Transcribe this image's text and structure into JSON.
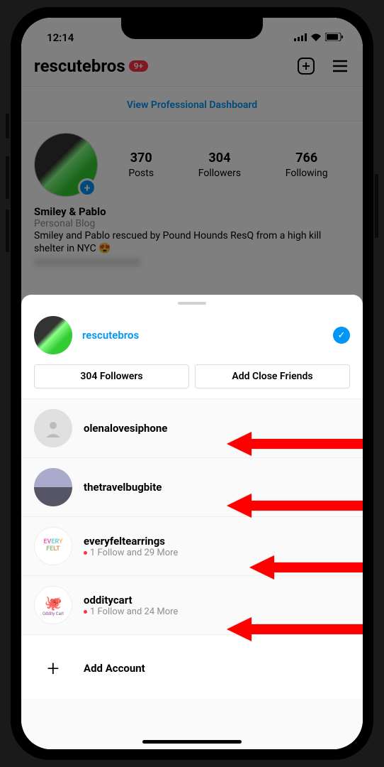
{
  "status": {
    "time": "12:14"
  },
  "header": {
    "username": "rescutebros",
    "notif_count": "9+"
  },
  "dashboard_link": "View Professional Dashboard",
  "stats": {
    "posts": {
      "value": "370",
      "label": "Posts"
    },
    "followers": {
      "value": "304",
      "label": "Followers"
    },
    "following": {
      "value": "766",
      "label": "Following"
    }
  },
  "bio": {
    "display_name": "Smiley & Pablo",
    "category": "Personal Blog",
    "text": "Smiley and Pablo rescued by Pound Hounds ResQ from a high kill shelter in NYC 😍"
  },
  "sheet": {
    "current_account": "rescutebros",
    "followers_btn": "304 Followers",
    "close_friends_btn": "Add Close Friends",
    "accounts": [
      {
        "username": "olenalovesiphone",
        "subtitle": ""
      },
      {
        "username": "thetravelbugbite",
        "subtitle": ""
      },
      {
        "username": "everyfeltearrings",
        "subtitle": "1 Follow and 29 More"
      },
      {
        "username": "odditycart",
        "subtitle": "1 Follow and 24 More"
      }
    ],
    "add_account": "Add Account"
  }
}
